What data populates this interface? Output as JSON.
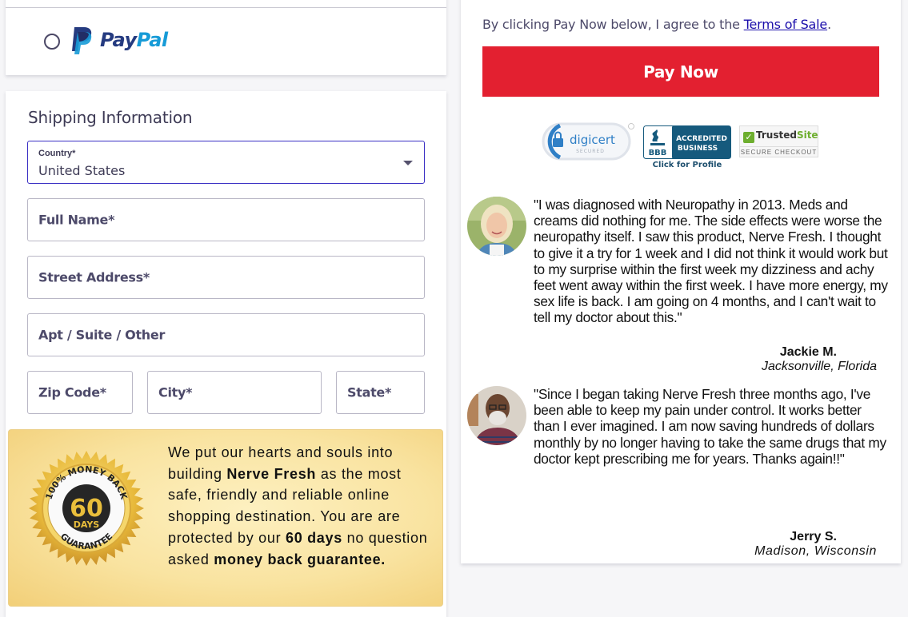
{
  "payment": {
    "paypal": {
      "label_pay": "Pay",
      "label_pal": "Pal",
      "selected": false
    }
  },
  "shipping": {
    "title": "Shipping Information",
    "country": {
      "label": "Country*",
      "value": "United States"
    },
    "fields": {
      "full_name": "Full Name*",
      "street": "Street Address*",
      "apt": "Apt / Suite / Other",
      "zip": "Zip Code*",
      "city": "City*",
      "state": "State*"
    }
  },
  "guarantee": {
    "seal": {
      "top": "100% MONEY BACK",
      "number": "60",
      "unit": "DAYS",
      "bottom": "GUARANTEE"
    },
    "text_1": "We put our hearts and souls into building ",
    "brand": "Nerve Fresh",
    "text_2": " as the most safe, friendly and reliable online shopping destination. You are are protected by our ",
    "days": "60 days",
    "text_3": " no question asked ",
    "mbg": "money back guarantee."
  },
  "checkout": {
    "terms_prefix": "By clicking Pay Now below, I agree to the ",
    "terms_link": "Terms of Sale",
    "terms_suffix": ".",
    "pay_button": "Pay Now",
    "badges": {
      "digicert": {
        "name": "digicert",
        "sub": "SECURED"
      },
      "bbb": {
        "line1": "ACCREDITED",
        "line2": "BUSINESS",
        "logo": "BBB",
        "click": "Click for Profile"
      },
      "trustedsite": {
        "trusted": "Trusted",
        "site": "Site",
        "sub": "SECURE CHECKOUT"
      }
    }
  },
  "testimonials": [
    {
      "quote": "\"I was diagnosed with Neuropathy in 2013. Meds and creams did nothing for me. The side effects were worse the neuropathy itself. I saw this product, Nerve Fresh. I thought to give it a try for 1 week and I did not think it would work but to my surprise within the first week my dizziness and achy feet went away within the first week. I have more energy, my sex life is back. I am going on 4 months, and I can't wait to tell my doctor about this.\"",
      "name": "Jackie M.",
      "location": "Jacksonville, Florida"
    },
    {
      "quote": "\"Since I began taking Nerve Fresh three months ago, I've been able to keep my pain under control. It works better than I ever imagined. I am now saving hundreds of dollars monthly by no longer having to take the same drugs that my doctor kept prescribing me for years. Thanks again!!\"",
      "name": "Jerry S.",
      "location": "Madison, Wisconsin"
    }
  ],
  "colors": {
    "pay_button": "#e32030",
    "select_border": "#3b30c4",
    "paypal_dark": "#253b80",
    "paypal_light": "#179bd7"
  }
}
